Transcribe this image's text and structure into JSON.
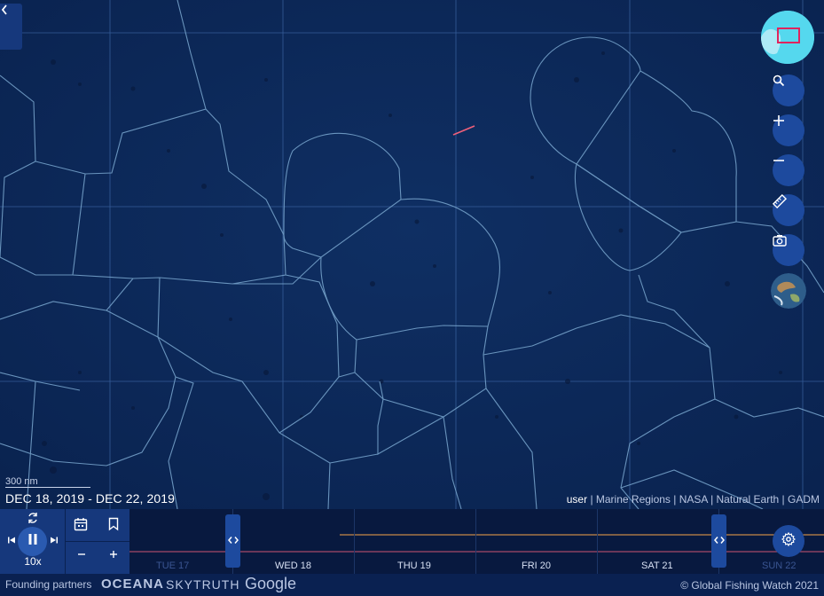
{
  "map": {
    "scale_label": "300 nm",
    "date_range": "DEC 18, 2019 - DEC 22, 2019",
    "attribution": {
      "user": "user",
      "sources": "| Marine Regions | NASA | Natural Earth | GADM"
    }
  },
  "timebar": {
    "speed": "10x",
    "days": [
      "TUE 17",
      "WED 18",
      "THU 19",
      "FRI 20",
      "SAT 21",
      "SUN 22"
    ]
  },
  "footer": {
    "partners_label": "Founding partners",
    "partner_oceana": "OCEANA",
    "partner_skytruth": "SKYTRUTH",
    "partner_google": "Google",
    "copyright": "© Global Fishing Watch 2021"
  },
  "colors": {
    "map_bg": "#0b2857",
    "eez_line": "#7aa7cf",
    "track_orange": "#f6a24a",
    "track_red": "#f0607a",
    "button_bg": "#1d4a9e",
    "minimap": "#4fd7ee"
  }
}
